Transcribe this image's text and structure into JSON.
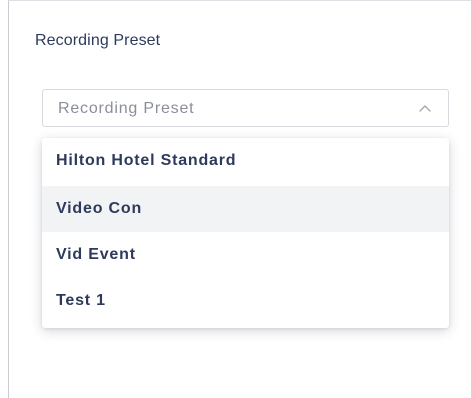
{
  "panel": {
    "title": "Recording Preset"
  },
  "select": {
    "placeholder": "Recording Preset",
    "expanded": true,
    "chevron_icon": "chevron-up-icon"
  },
  "dropdown": {
    "options": [
      {
        "label": "Hilton Hotel Standard"
      },
      {
        "label": "Video Con",
        "highlighted": true
      },
      {
        "label": "Vid Event"
      },
      {
        "label": "Test 1"
      }
    ]
  },
  "colors": {
    "text_primary": "#2d3a5c",
    "placeholder": "#8a8f97",
    "highlight_bg": "#f2f3f5",
    "border": "#d6d9de"
  }
}
